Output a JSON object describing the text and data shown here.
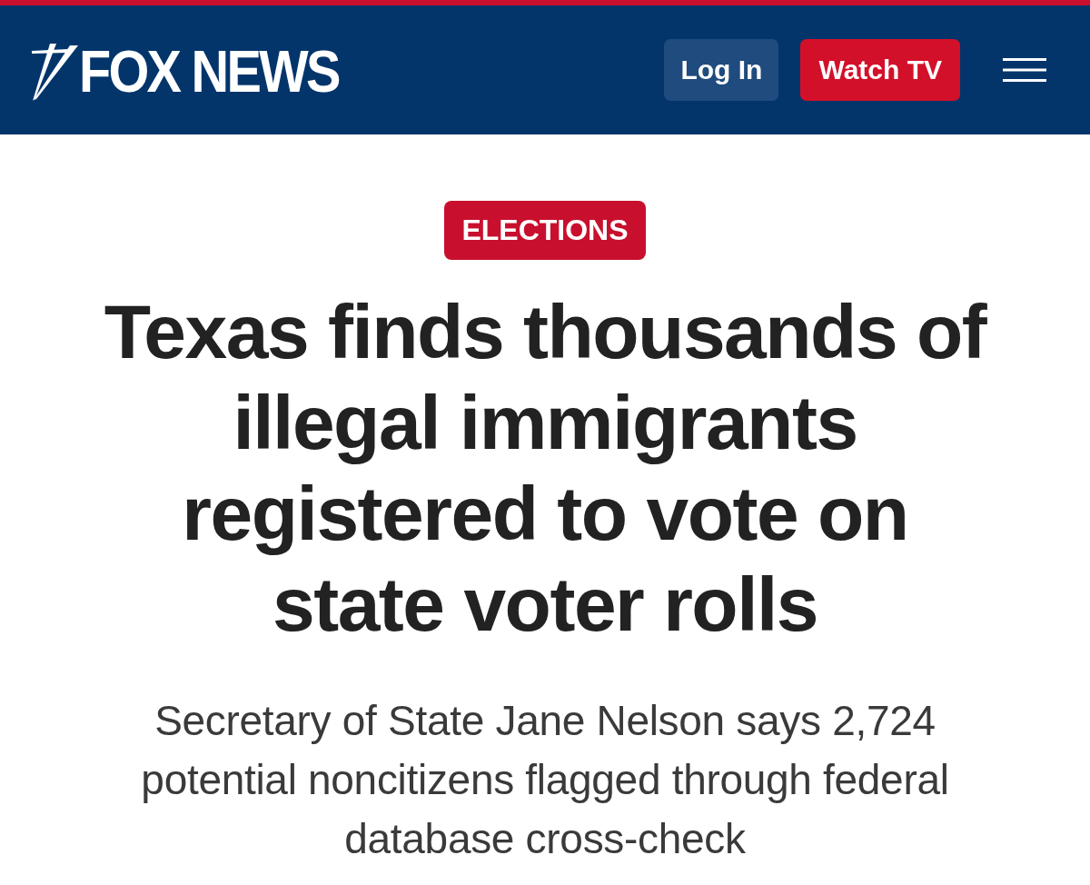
{
  "header": {
    "logo": "FOX NEWS",
    "buttons": [
      {
        "label": "Log In",
        "kind": "secondary"
      },
      {
        "label": "Watch TV",
        "kind": "primary"
      }
    ]
  },
  "article": {
    "category": "ELECTIONS",
    "headline": "Texas finds thousands of illegal immigrants registered to vote on state voter rolls",
    "subheadline": "Secretary of State Jane Nelson says 2,724 potential noncitizens flagged through federal database cross-check"
  }
}
